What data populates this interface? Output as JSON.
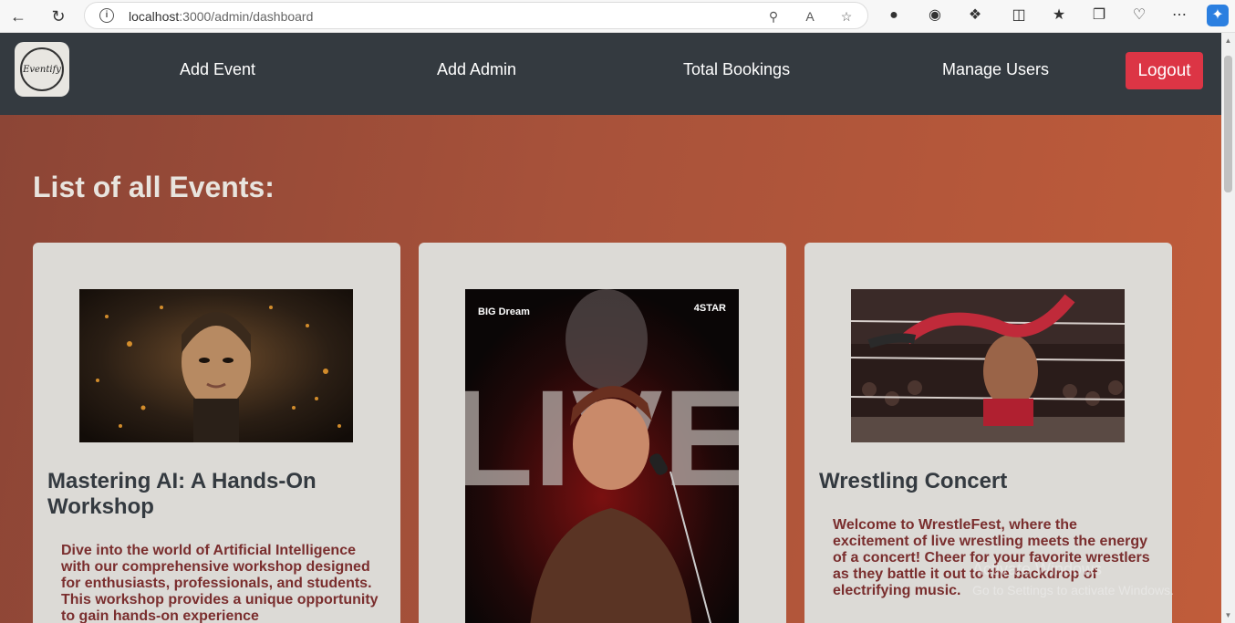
{
  "browser": {
    "url_host": "localhost",
    "url_rest": ":3000/admin/dashboard"
  },
  "navbar": {
    "logo_text": "Eventify",
    "links": [
      "Add Event",
      "Add Admin",
      "Total Bookings",
      "Manage Users"
    ],
    "logout_label": "Logout"
  },
  "main": {
    "title": "List of all Events:",
    "events": [
      {
        "title": "Mastering AI: A Hands-On Workshop",
        "description": "Dive into the world of Artificial Intelligence with our comprehensive workshop designed for enthusiasts, professionals, and students. This workshop provides a unique opportunity to gain hands-on experience"
      },
      {
        "title": "",
        "description": "",
        "poster_brand_left": "BIG Dream",
        "poster_brand_right": "4STAR",
        "poster_word": "LIVE"
      },
      {
        "title": "Wrestling Concert",
        "description": "Welcome to WrestleFest, where the excitement of live wrestling meets the energy of a concert! Cheer for your favorite wrestlers as they battle it out to the backdrop of electrifying music."
      }
    ]
  },
  "watermark": {
    "line1": "Activate Windows",
    "line2": "Go to Settings to activate Windows."
  },
  "colors": {
    "navbar_bg": "#343a40",
    "logout_bg": "#dc3545",
    "card_bg": "#dcdad6",
    "description_text": "#7a2e2e"
  }
}
